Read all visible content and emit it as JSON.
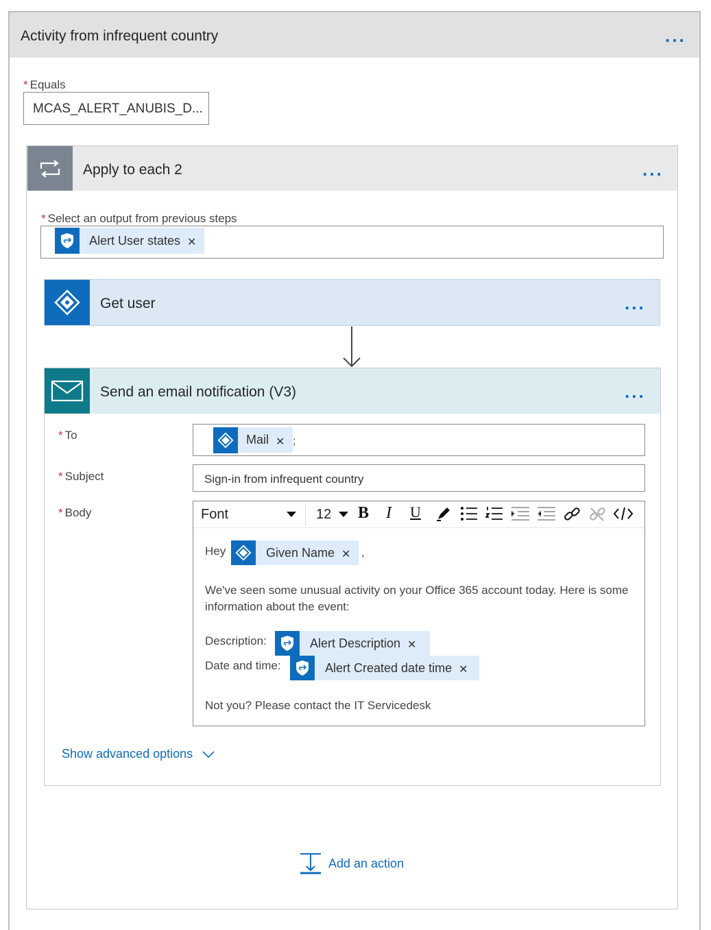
{
  "header": {
    "title": "Activity from infrequent country",
    "more": "..."
  },
  "condition": {
    "label": "Equals",
    "value": "MCAS_ALERT_ANUBIS_D..."
  },
  "loop": {
    "title": "Apply to each 2",
    "more": "...",
    "output_label": "Select an output from previous steps",
    "output_token": "Alert User states"
  },
  "get_user": {
    "title": "Get user",
    "more": "..."
  },
  "email": {
    "title": "Send an email notification (V3)",
    "more": "...",
    "to_label": "To",
    "to_token": "Mail",
    "to_sep": ";",
    "subject_label": "Subject",
    "subject_value": "Sign-in from infrequent country",
    "body_label": "Body",
    "toolbar": {
      "font": "Font",
      "size": "12"
    },
    "body": {
      "greeting": "Hey",
      "greeting_token": "Given Name",
      "greeting_sep": ",",
      "paragraph": "We've seen some unusual activity on your Office 365 account today. Here is some information about the event:",
      "desc_label": "Description:",
      "desc_token": "Alert Description",
      "date_label": "Date and time:",
      "date_token": "Alert Created date time",
      "footer": "Not you? Please contact the IT Servicedesk"
    },
    "advanced": "Show advanced options"
  },
  "add_action": "Add an action",
  "colors": {
    "accent": "#0f6cbd",
    "token_bg": "#deecf9",
    "header_bg": "#e1e1e1",
    "loop_icon_bg": "#7a8591",
    "email_icon_bg": "#0e7a8a"
  }
}
